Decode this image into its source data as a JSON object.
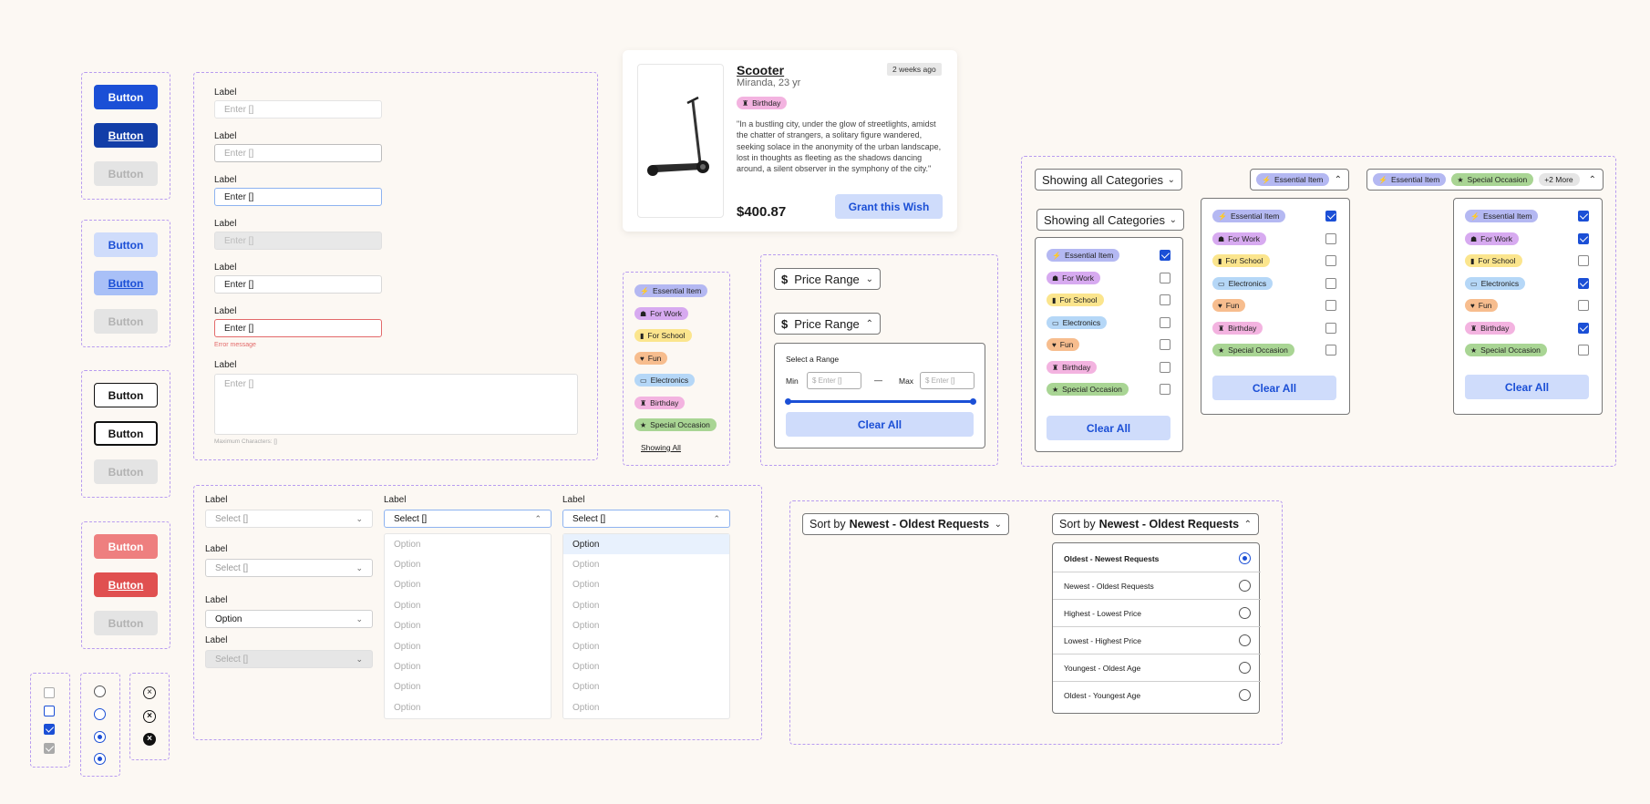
{
  "buttons": {
    "label": "Button"
  },
  "inputs": {
    "label": "Label",
    "placeholder": "Enter []",
    "error_message": "Error message",
    "max_chars": "Maximum Characters: []"
  },
  "selects": {
    "label": "Label",
    "placeholder": "Select []",
    "option_value": "Option",
    "options": [
      "Option",
      "Option",
      "Option",
      "Option",
      "Option",
      "Option",
      "Option",
      "Option",
      "Option"
    ]
  },
  "wish_card": {
    "title": "Scooter",
    "subtitle": "Miranda, 23 yr",
    "time_badge": "2 weeks ago",
    "tag": "Birthday",
    "quote": "\"In a bustling city, under the glow of streetlights, amidst the chatter of strangers, a solitary figure wandered, seeking solace in the anonymity of the urban landscape, lost in thoughts as fleeting as the shadows dancing around, a silent observer in the symphony of the city.\"",
    "price": "$400.87",
    "cta": "Grant this Wish"
  },
  "categories": [
    {
      "name": "Essential Item",
      "icon": "bolt-icon"
    },
    {
      "name": "For Work",
      "icon": "briefcase-icon"
    },
    {
      "name": "For School",
      "icon": "book-icon"
    },
    {
      "name": "Electronics",
      "icon": "monitor-icon"
    },
    {
      "name": "Fun",
      "icon": "heart-icon"
    },
    {
      "name": "Birthday",
      "icon": "cake-icon"
    },
    {
      "name": "Special Occasion",
      "icon": "star-icon"
    }
  ],
  "tag_column": {
    "items": [
      "Essential Item",
      "For Work",
      "For School",
      "Fun",
      "Electronics",
      "Birthday",
      "Special Occasion"
    ],
    "showing_all": "Showing All"
  },
  "price_range": {
    "label": "Price Range",
    "select_range": "Select a Range",
    "min_label": "Min",
    "max_label": "Max",
    "min_placeholder": "$ Enter []",
    "max_placeholder": "$ Enter []",
    "dash": "—",
    "clear": "Clear All"
  },
  "category_filter": {
    "showing_all": "Showing all Categories",
    "clear": "Clear All",
    "more": "+2 More"
  },
  "sort": {
    "prefix": "Sort by",
    "value": "Newest - Oldest Requests",
    "options": [
      "Oldest - Newest Requests",
      "Newest - Oldest Requests",
      "Highest - Lowest Price",
      "Lowest - Highest Price",
      "Youngest - Oldest Age",
      "Oldest - Youngest Age"
    ]
  },
  "colors": {
    "primary": "#1b4fd6",
    "danger": "#e05050",
    "accent_dash": "#b89cf0"
  }
}
